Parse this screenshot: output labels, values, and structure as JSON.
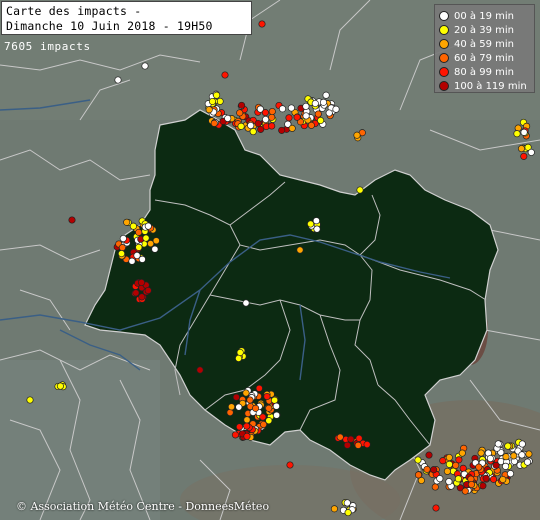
{
  "title": {
    "line1": "Carte des impacts -",
    "line2": "Dimanche 10 Juin 2018 - 19H50"
  },
  "impact_count": "7605 impacts",
  "legend": [
    {
      "label": "00 à 19 min",
      "color": "#ffffff"
    },
    {
      "label": "20 à 39 min",
      "color": "#ffff00"
    },
    {
      "label": "40 à 59 min",
      "color": "#ffa500"
    },
    {
      "label": "60 à 79 min",
      "color": "#ff6400"
    },
    {
      "label": "80 à 99 min",
      "color": "#ff1400"
    },
    {
      "label": "100 à 119 min",
      "color": "#b40000"
    }
  ],
  "credit": "© Association Météo Centre - DonneesMéteo",
  "colors": {
    "background": "#6f7a72",
    "region_fill": "#0c2a12",
    "border": "#c8c8c8",
    "river": "#3a5f86"
  }
}
